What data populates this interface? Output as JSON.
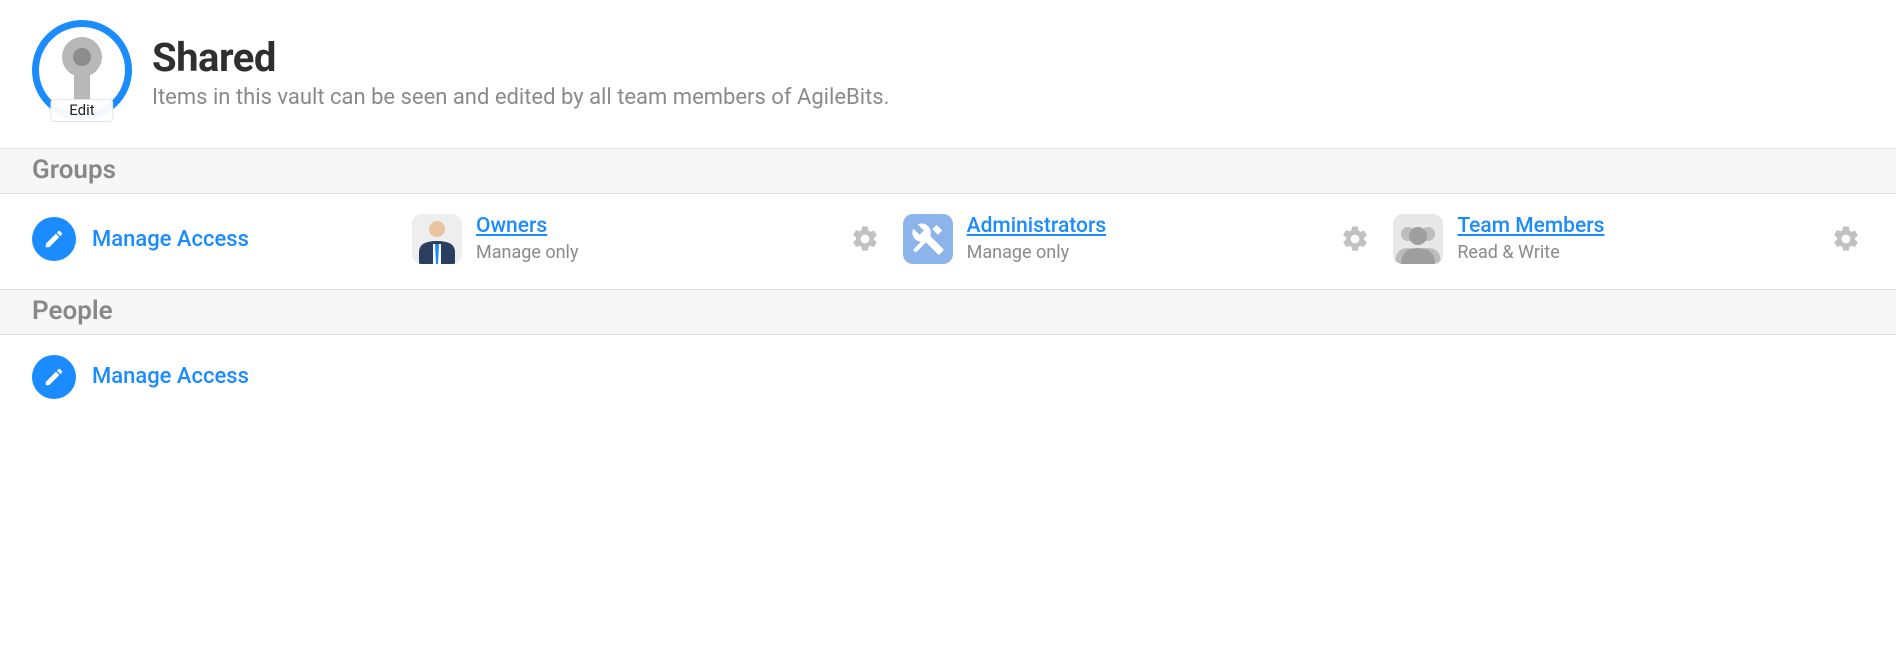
{
  "vault": {
    "title": "Shared",
    "description": "Items in this vault can be seen and edited by all team members of AgileBits.",
    "edit_label": "Edit"
  },
  "sections": {
    "groups": {
      "heading": "Groups",
      "manage_label": "Manage Access",
      "items": [
        {
          "name": "Owners",
          "permission": "Manage only",
          "icon": "owners"
        },
        {
          "name": "Administrators",
          "permission": "Manage only",
          "icon": "admins"
        },
        {
          "name": "Team Members",
          "permission": "Read & Write",
          "icon": "team"
        }
      ]
    },
    "people": {
      "heading": "People",
      "manage_label": "Manage Access"
    }
  }
}
